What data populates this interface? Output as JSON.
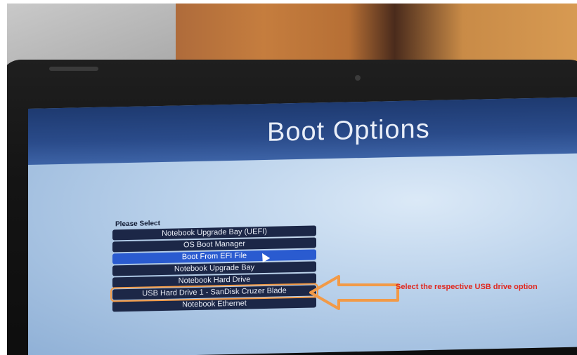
{
  "screen": {
    "title": "Boot Options",
    "menu_label": "Please Select",
    "options": [
      "Notebook Upgrade Bay (UEFI)",
      "OS Boot Manager",
      "Boot From EFI File",
      "Notebook Upgrade Bay",
      "Notebook Hard Drive",
      "USB Hard Drive 1 - SanDisk Cruzer Blade",
      "Notebook Ethernet"
    ],
    "selected_option": "Boot From EFI File"
  },
  "annotation": {
    "text": "Select the respective USB drive option",
    "color": "#e0281f",
    "arrow_color": "#f29a47",
    "highlighted_option": "USB Hard Drive 1 - SanDisk Cruzer Blade"
  },
  "icons": {
    "cursor": "mouse-pointer-icon",
    "arrow": "left-arrow-icon"
  }
}
